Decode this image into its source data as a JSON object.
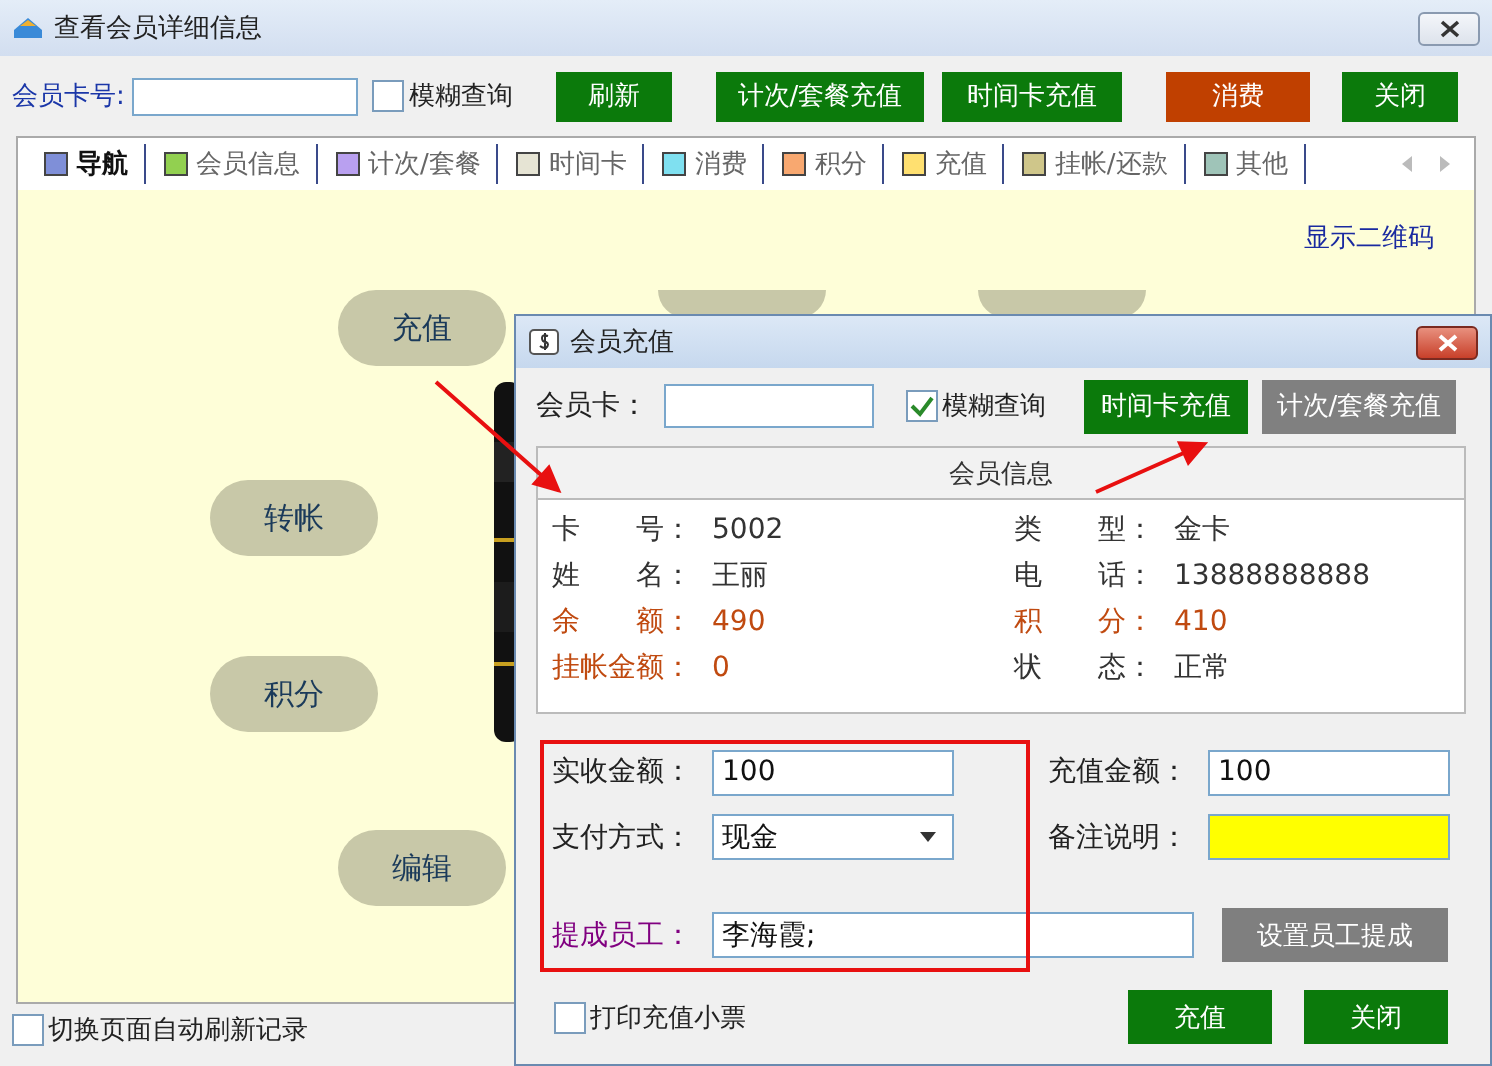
{
  "window": {
    "title": "查看会员详细信息"
  },
  "toolbar": {
    "card_label": "会员卡号:",
    "fuzzy": {
      "label": "模糊查询",
      "checked": false
    },
    "buttons": [
      {
        "label": "刷新",
        "color": "#0b7a0b"
      },
      {
        "label": "计次/套餐充值",
        "color": "#0b7a0b"
      },
      {
        "label": "时间卡充值",
        "color": "#0b7a0b"
      },
      {
        "label": "消费",
        "color": "#c04000"
      },
      {
        "label": "关闭",
        "color": "#0b7a0b"
      }
    ]
  },
  "tabs": [
    {
      "label": "导航",
      "color": "#7f8fd8",
      "selected": true
    },
    {
      "label": "会员信息",
      "color": "#92d050",
      "selected": false
    },
    {
      "label": "计次/套餐",
      "color": "#b9a0f0",
      "selected": false
    },
    {
      "label": "时间卡",
      "color": "#e6e4d4",
      "selected": false
    },
    {
      "label": "消费",
      "color": "#7fe0f0",
      "selected": false
    },
    {
      "label": "积分",
      "color": "#f8a870",
      "selected": false
    },
    {
      "label": "充值",
      "color": "#ffe070",
      "selected": false
    },
    {
      "label": "挂帐/还款",
      "color": "#cfc68a",
      "selected": false
    },
    {
      "label": "其他",
      "color": "#9fc4b8",
      "selected": false
    }
  ],
  "qr_link": "显示二维码",
  "nav_bubbles": [
    "充值",
    "转帐",
    "积分",
    "编辑"
  ],
  "footer": {
    "auto_refresh": {
      "label": "切换页面自动刷新记录",
      "checked": false
    }
  },
  "dialog": {
    "title": "会员充值",
    "card_label": "会员卡：",
    "fuzzy": {
      "label": "模糊查询",
      "checked": true
    },
    "buttons": [
      {
        "label": "时间卡充值",
        "color": "#0b7a0b"
      },
      {
        "label": "计次/套餐充值",
        "color": "#808080"
      }
    ],
    "info_title": "会员信息",
    "info": [
      {
        "label": "卡　　号：",
        "value": "5002",
        "kind": "normal"
      },
      {
        "label": "类　　型：",
        "value": "金卡",
        "kind": "normal"
      },
      {
        "label": "姓　　名：",
        "value": "王丽",
        "kind": "normal"
      },
      {
        "label": "电　　话：",
        "value": "13888888888",
        "kind": "normal"
      },
      {
        "label": "余　　额：",
        "value": "490",
        "kind": "money"
      },
      {
        "label": "积　　分：",
        "value": "410",
        "kind": "money"
      },
      {
        "label": "挂帐金额：",
        "value": "0",
        "kind": "money"
      },
      {
        "label": "状　　态：",
        "value": "正常",
        "kind": "normal"
      }
    ],
    "received": {
      "label": "实收金额：",
      "value": "100"
    },
    "recharge": {
      "label": "充值金额：",
      "value": "100"
    },
    "payment": {
      "label": "支付方式：",
      "value": "现金"
    },
    "note": {
      "label": "备注说明："
    },
    "staff": {
      "label": "提成员工：",
      "value": "李海霞;"
    },
    "staff_button": "设置员工提成",
    "print": {
      "label": "打印充值小票",
      "checked": false
    },
    "actions": [
      "充值",
      "关闭"
    ]
  }
}
